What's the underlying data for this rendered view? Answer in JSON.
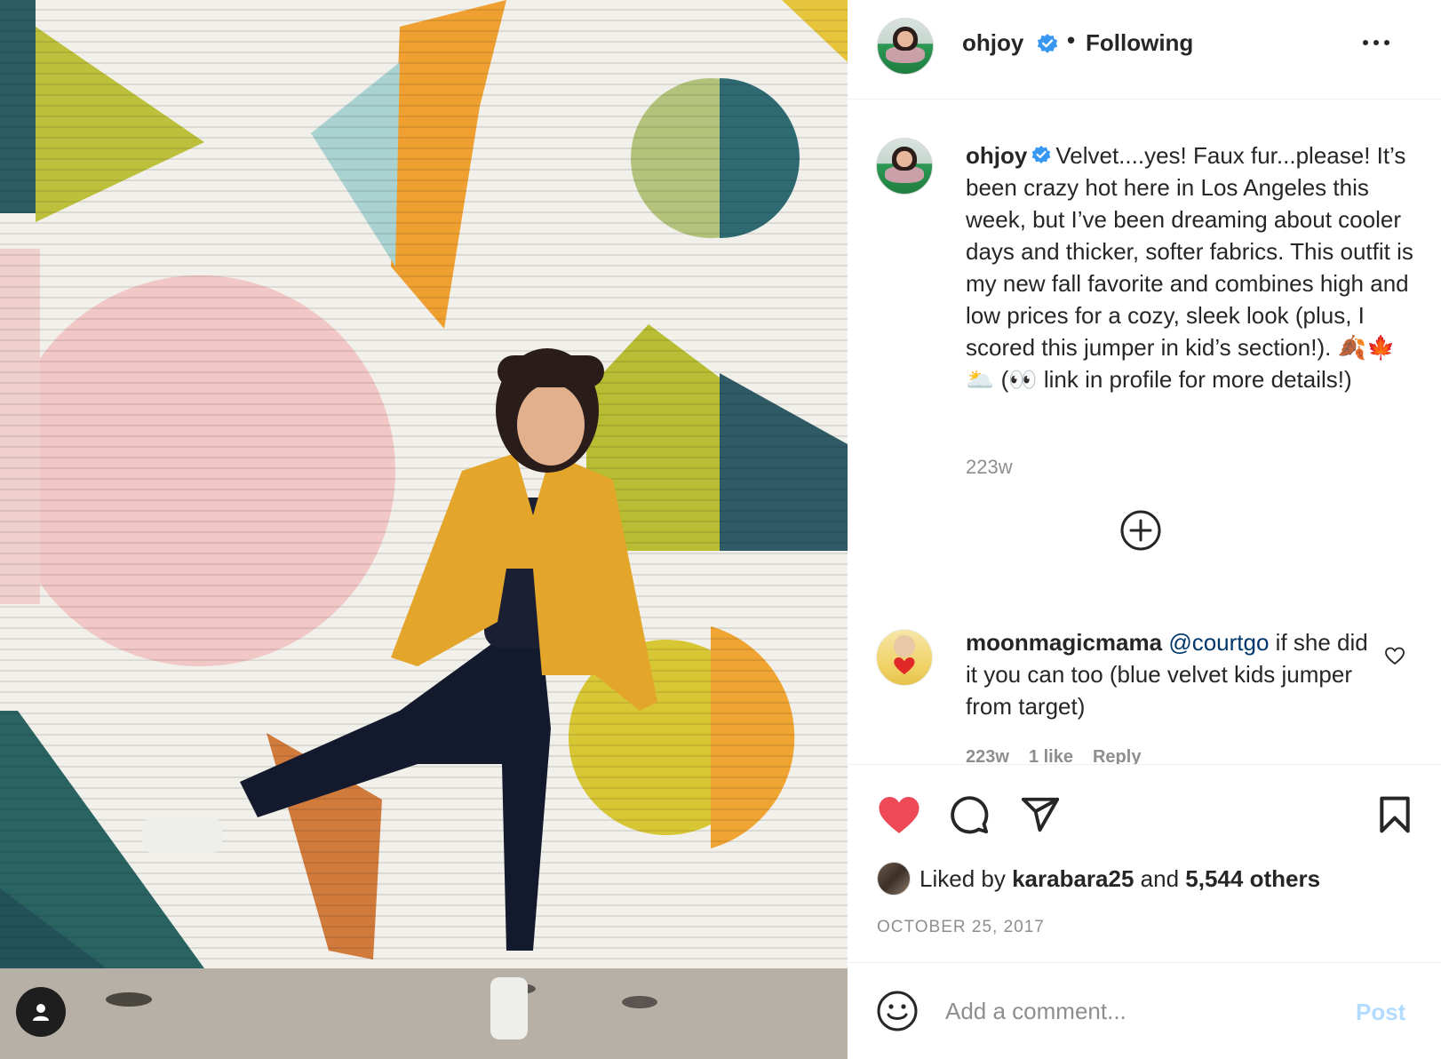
{
  "header": {
    "username": "ohjoy",
    "separator": "•",
    "follow_status": "Following"
  },
  "caption": {
    "username": "ohjoy",
    "text": "Velvet....yes! Faux fur...please! It’s been crazy hot here in Los Angeles this week, but I’ve been dreaming about cooler days and thicker, softer fabrics. This outfit is my new fall favorite and combines high and low prices for a cozy, sleek look (plus, I scored this jumper in kid’s section!). 🍂🍁🌥️ (👀 link in profile for more details!)",
    "time": "223w"
  },
  "comment": {
    "username": "moonmagicmama",
    "mention": "@courtgo",
    "text": " if she did it you can too (blue velvet kids jumper from target)",
    "time": "223w",
    "likes": "1 like",
    "reply": "Reply"
  },
  "likes": {
    "prefix": "Liked by",
    "user": "karabara25",
    "middle": "and",
    "others": "5,544 others"
  },
  "date": "OCTOBER 25, 2017",
  "add_comment": {
    "placeholder": "Add a comment...",
    "post_label": "Post"
  },
  "colors": {
    "like_red": "#ed4956",
    "verified_blue": "#3897f0",
    "post_disabled": "#b3dbff",
    "mention": "#00376b"
  },
  "icons": [
    "more-icon",
    "verified-icon",
    "add-circle-icon",
    "heart-icon",
    "comment-icon",
    "share-icon",
    "bookmark-icon",
    "emoji-icon",
    "person-icon"
  ]
}
